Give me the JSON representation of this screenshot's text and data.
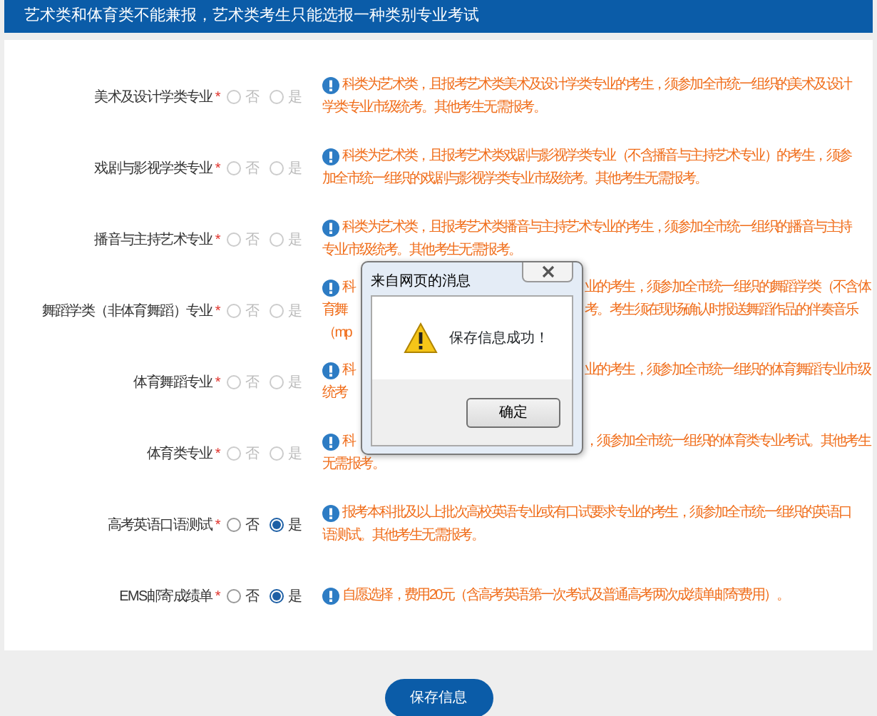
{
  "header": {
    "title": "艺术类和体育类不能兼报，艺术类考生只能选报一种类别专业考试"
  },
  "rows": [
    {
      "label": "美术及设计学类专业",
      "marker": "*",
      "disabled": true,
      "options": [
        {
          "label": "否",
          "selected": false
        },
        {
          "label": "是",
          "selected": false
        }
      ],
      "note": [
        {
          "text": "科类为艺术类，且报考艺术类美术及设计学类专业的考生，须参加全市统一组织的美术及设计"
        },
        {
          "text": "学类专业市级统考。其他考生无需报考。"
        }
      ]
    },
    {
      "label": "戏剧与影视学类专业",
      "marker": "*",
      "disabled": true,
      "options": [
        {
          "label": "否",
          "selected": false
        },
        {
          "label": "是",
          "selected": false
        }
      ],
      "note": [
        {
          "text": "科类为艺术类，且报考艺术类戏剧与影视学类专业（不含播音与主持艺术专业）的考生，须参"
        },
        {
          "text": "加全市统一组织的戏剧与影视学类专业市级统考。其他考生无需报考。"
        }
      ]
    },
    {
      "label": "播音与主持艺术专业",
      "marker": "*",
      "disabled": true,
      "options": [
        {
          "label": "否",
          "selected": false
        },
        {
          "label": "是",
          "selected": false
        }
      ],
      "note": [
        {
          "text": "科类为艺术类，且报考艺术类播音与主持艺术专业的考生，须参加全市统一组织的播音与主持"
        },
        {
          "text": "专业市级统考。其他考生无需报考。"
        }
      ]
    },
    {
      "label": "舞蹈学类（非体育舞蹈）专业",
      "marker": "*",
      "disabled": true,
      "options": [
        {
          "label": "否",
          "selected": false
        },
        {
          "label": "是",
          "selected": false
        }
      ],
      "note": [
        {
          "text": "科",
          "after": "业的考生，须参加全市统一组织的舞蹈学类（不含体"
        },
        {
          "text": "育舞",
          "after": "考。考生须在现场确认时报送舞蹈作品的伴奏音乐"
        },
        {
          "text": "（mp"
        }
      ]
    },
    {
      "label": "体育舞蹈专业",
      "marker": "*",
      "disabled": true,
      "options": [
        {
          "label": "否",
          "selected": false
        },
        {
          "label": "是",
          "selected": false
        }
      ],
      "note": [
        {
          "text": "科",
          "after": "业的考生，须参加全市统一组织的体育舞蹈专业市级"
        },
        {
          "text": "统考"
        }
      ]
    },
    {
      "label": "体育类专业",
      "marker": "*",
      "disabled": true,
      "options": [
        {
          "label": "否",
          "selected": false
        },
        {
          "label": "是",
          "selected": false
        }
      ],
      "note": [
        {
          "text": "科",
          "after": "，须参加全市统一组织的体育类专业考试。其他考生"
        },
        {
          "text": "无需报考。"
        }
      ]
    },
    {
      "label": "高考英语口语测试",
      "marker": "*",
      "disabled": false,
      "options": [
        {
          "label": "否",
          "selected": false
        },
        {
          "label": "是",
          "selected": true
        }
      ],
      "note": [
        {
          "text": "报考本科批及以上批次高校英语专业或有口试要求专业的考生，须参加全市统一组织的英语口"
        },
        {
          "text": "语测试。其他考生无需报考。"
        }
      ]
    },
    {
      "label": "EMS邮寄成绩单",
      "marker": "*",
      "disabled": false,
      "options": [
        {
          "label": "否",
          "selected": false
        },
        {
          "label": "是",
          "selected": true
        }
      ],
      "note": [
        {
          "text": "自愿选择，费用20元（含高考英语第一次考试及普通高考两次成绩单邮寄费用）。"
        }
      ]
    }
  ],
  "dialog": {
    "title": "来自网页的消息",
    "message": "保存信息成功！",
    "button": "确定"
  },
  "save_button": "保存信息"
}
